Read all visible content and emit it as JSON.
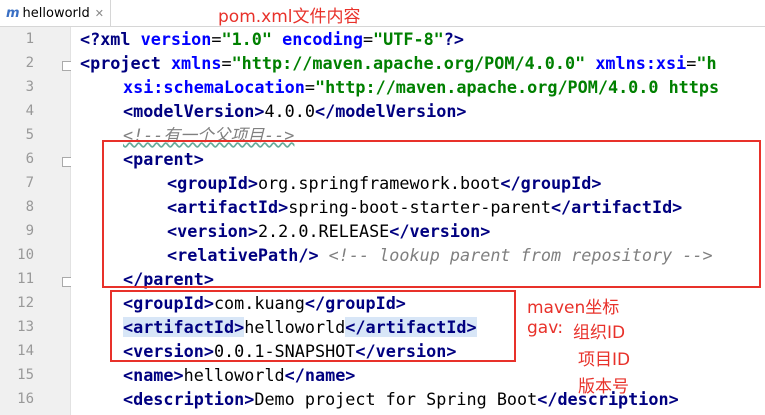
{
  "tab": {
    "icon": "m",
    "label": "helloworld",
    "close": "✕"
  },
  "annotations": {
    "title": "pom.xml文件内容",
    "gav_title": "maven坐标",
    "gav_label": "gav:",
    "group_id": "组织ID",
    "artifact_id": "项目ID",
    "version": "版本号"
  },
  "line_numbers": [
    "1",
    "2",
    "3",
    "4",
    "5",
    "6",
    "7",
    "8",
    "9",
    "10",
    "11",
    "12",
    "13",
    "14",
    "15",
    "16"
  ],
  "code": {
    "l1": {
      "open": "<?xml ",
      "a1": "version",
      "eq1": "=",
      "v1": "\"1.0\"",
      "sp": " ",
      "a2": "encoding",
      "eq2": "=",
      "v2": "\"UTF-8\"",
      "close": "?>"
    },
    "l2": {
      "open": "<project ",
      "a1": "xmlns",
      "eq1": "=",
      "v1": "\"http://maven.apache.org/POM/4.0.0\"",
      "sp": " ",
      "a2": "xmlns:xsi",
      "eq2": "=",
      "v2": "\"h"
    },
    "l3": {
      "a1": "xsi:schemaLocation",
      "eq1": "=",
      "v1": "\"http://maven.apache.org/POM/4.0.0 https"
    },
    "l4": {
      "open": "<modelVersion>",
      "text": "4.0.0",
      "close": "</modelVersion>"
    },
    "l5": {
      "comment": "<!--有一个父项目-->"
    },
    "l6": {
      "open": "<parent>"
    },
    "l7": {
      "open": "<groupId>",
      "text": "org.springframework.boot",
      "close": "</groupId>"
    },
    "l8": {
      "open": "<artifactId>",
      "text": "spring-boot-starter-parent",
      "close": "</artifactId>"
    },
    "l9": {
      "open": "<version>",
      "text": "2.2.0.RELEASE",
      "close": "</version>"
    },
    "l10": {
      "open": "<relativePath/>",
      "sp": " ",
      "comment": "<!-- lookup parent from repository -->"
    },
    "l11": {
      "close": "</parent>"
    },
    "l12": {
      "open": "<groupId>",
      "text": "com.kuang",
      "close": "</groupId>"
    },
    "l13": {
      "open": "<artifactId>",
      "text": "helloworld",
      "close": "</artifactId>"
    },
    "l14": {
      "open": "<version>",
      "text": "0.0.1-SNAPSHOT",
      "close": "</version>"
    },
    "l15": {
      "open": "<name>",
      "text": "helloworld",
      "close": "</name>"
    },
    "l16": {
      "open": "<description>",
      "text": "Demo project for Spring Boot",
      "close": "</description>"
    }
  },
  "colors": {
    "annotation_red": "#e8312a",
    "tag_navy": "#000080",
    "attr_blue": "#0000ff",
    "value_green": "#008000",
    "comment_gray": "#808080"
  }
}
